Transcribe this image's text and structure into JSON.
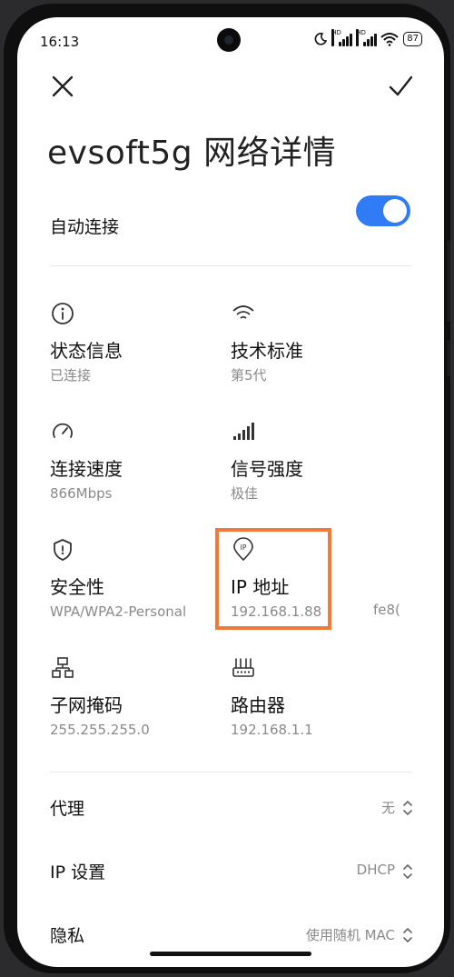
{
  "status_bar": {
    "time": "16:13",
    "hd_badge": "HD",
    "battery": "87"
  },
  "header": {
    "title": "evsoft5g 网络详情",
    "close_icon": "close-icon",
    "confirm_icon": "check-icon"
  },
  "auto_connect": {
    "label": "自动连接",
    "enabled": true
  },
  "details": [
    {
      "label": "状态信息",
      "value": "已连接",
      "icon": "info-icon"
    },
    {
      "label": "技术标准",
      "value": "第5代",
      "icon": "wifi-icon"
    },
    {
      "label": "连接速度",
      "value": "866Mbps",
      "icon": "speedometer-icon"
    },
    {
      "label": "信号强度",
      "value": "极佳",
      "icon": "signal-bars-icon"
    },
    {
      "label": "安全性",
      "value": "WPA/WPA2-Personal",
      "icon": "shield-icon"
    },
    {
      "label": "IP 地址",
      "value": "192.168.1.88",
      "icon": "ip-pin-icon",
      "extra_value": "fe8("
    },
    {
      "label": "子网掩码",
      "value": "255.255.255.0",
      "icon": "network-tree-icon"
    },
    {
      "label": "路由器",
      "value": "192.168.1.1",
      "icon": "router-icon"
    }
  ],
  "ip_pin_text": "IP",
  "settings": [
    {
      "label": "代理",
      "value": "无"
    },
    {
      "label": "IP 设置",
      "value": "DHCP"
    },
    {
      "label": "隐私",
      "value": "使用随机 MAC"
    }
  ],
  "colors": {
    "accent": "#2f7cf4",
    "highlight": "#f07a3c"
  }
}
